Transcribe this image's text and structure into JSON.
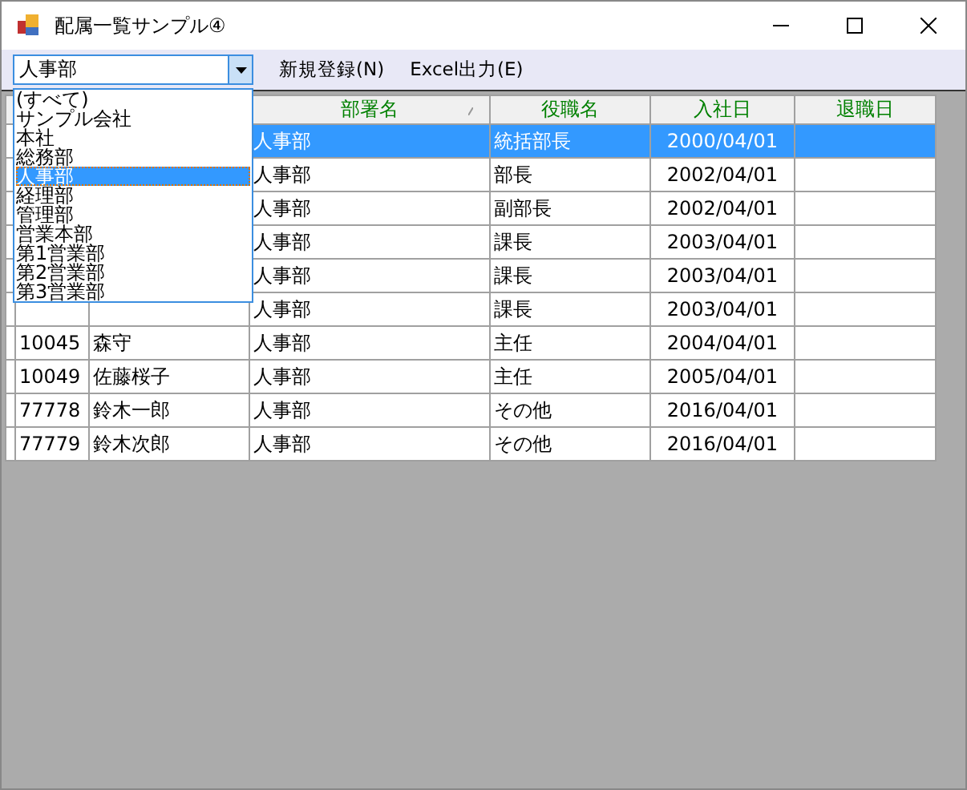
{
  "window": {
    "title": "配属一覧サンプル④"
  },
  "toolbar": {
    "combo": {
      "value": "人事部",
      "options": [
        {
          "label": "(すべて)",
          "selected": false
        },
        {
          "label": "サンプル会社",
          "selected": false
        },
        {
          "label": "本社",
          "selected": false
        },
        {
          "label": "総務部",
          "selected": false
        },
        {
          "label": "人事部",
          "selected": true
        },
        {
          "label": "経理部",
          "selected": false
        },
        {
          "label": "管理部",
          "selected": false
        },
        {
          "label": "営業本部",
          "selected": false
        },
        {
          "label": "第1営業部",
          "selected": false
        },
        {
          "label": "第2営業部",
          "selected": false
        },
        {
          "label": "第3営業部",
          "selected": false
        }
      ]
    },
    "menu": [
      "新規登録(N)",
      "Excel出力(E)"
    ]
  },
  "table": {
    "columns": [
      {
        "label": "部署名",
        "sort_glyph": true
      },
      {
        "label": "役職名",
        "sort_glyph": false
      },
      {
        "label": "入社日",
        "sort_glyph": false
      },
      {
        "label": "退職日",
        "sort_glyph": false
      }
    ],
    "rows": [
      {
        "department": "人事部",
        "position": "統括部長",
        "hire_date": "2000/04/01",
        "selected": true
      },
      {
        "department": "人事部",
        "position": "部長",
        "hire_date": "2002/04/01",
        "selected": false
      },
      {
        "department": "人事部",
        "position": "副部長",
        "hire_date": "2002/04/01",
        "selected": false
      },
      {
        "department": "人事部",
        "position": "課長",
        "hire_date": "2003/04/01",
        "selected": false
      },
      {
        "department": "人事部",
        "position": "課長",
        "hire_date": "2003/04/01",
        "selected": false
      },
      {
        "department": "人事部",
        "position": "課長",
        "hire_date": "2003/04/01",
        "selected": false
      },
      {
        "id": "10045",
        "name": "森守",
        "department": "人事部",
        "position": "主任",
        "hire_date": "2004/04/01",
        "selected": false
      },
      {
        "id": "10049",
        "name": "佐藤桜子",
        "department": "人事部",
        "position": "主任",
        "hire_date": "2005/04/01",
        "selected": false
      },
      {
        "id": "77778",
        "name": "鈴木一郎",
        "department": "人事部",
        "position": "その他",
        "hire_date": "2016/04/01",
        "selected": false
      },
      {
        "id": "77779",
        "name": "鈴木次郎",
        "department": "人事部",
        "position": "その他",
        "hire_date": "2016/04/01",
        "selected": false
      }
    ]
  }
}
